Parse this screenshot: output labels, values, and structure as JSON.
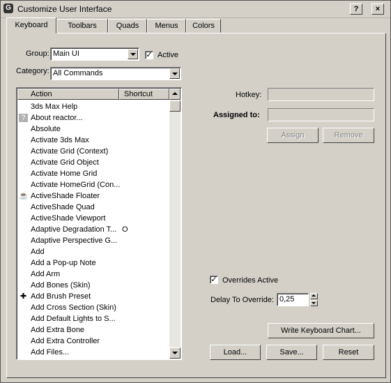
{
  "window": {
    "title": "Customize User Interface",
    "help_button": "?",
    "close_button": "×",
    "icon": "app-logo-icon"
  },
  "tabs": [
    "Keyboard",
    "Toolbars",
    "Quads",
    "Menus",
    "Colors"
  ],
  "active_tab": "Keyboard",
  "group": {
    "label": "Group:",
    "value": "Main UI"
  },
  "active_checkbox": {
    "label": "Active",
    "checked": true
  },
  "category": {
    "label": "Category:",
    "value": "All Commands"
  },
  "action_list": {
    "columns": [
      "Action",
      "Shortcut"
    ],
    "rows": [
      {
        "action": "3ds Max Help",
        "shortcut": "",
        "icon": ""
      },
      {
        "action": "About reactor...",
        "shortcut": "",
        "icon": "question-icon"
      },
      {
        "action": "Absolute",
        "shortcut": "",
        "icon": ""
      },
      {
        "action": "Activate 3ds Max",
        "shortcut": "",
        "icon": ""
      },
      {
        "action": "Activate Grid (Context)",
        "shortcut": "",
        "icon": ""
      },
      {
        "action": "Activate Grid Object",
        "shortcut": "",
        "icon": ""
      },
      {
        "action": "Activate Home Grid",
        "shortcut": "",
        "icon": ""
      },
      {
        "action": "Activate HomeGrid (Con...",
        "shortcut": "",
        "icon": ""
      },
      {
        "action": "ActiveShade Floater",
        "shortcut": "",
        "icon": "teapot-icon"
      },
      {
        "action": "ActiveShade Quad",
        "shortcut": "",
        "icon": ""
      },
      {
        "action": "ActiveShade Viewport",
        "shortcut": "",
        "icon": ""
      },
      {
        "action": "Adaptive Degradation T...",
        "shortcut": "O",
        "icon": ""
      },
      {
        "action": "Adaptive Perspective G...",
        "shortcut": "",
        "icon": ""
      },
      {
        "action": "Add",
        "shortcut": "",
        "icon": ""
      },
      {
        "action": "Add a Pop-up Note",
        "shortcut": "",
        "icon": ""
      },
      {
        "action": "Add Arm",
        "shortcut": "",
        "icon": ""
      },
      {
        "action": "Add Bones (Skin)",
        "shortcut": "",
        "icon": ""
      },
      {
        "action": "Add Brush Preset",
        "shortcut": "",
        "icon": "plus-icon"
      },
      {
        "action": "Add Cross Section (Skin)",
        "shortcut": "",
        "icon": ""
      },
      {
        "action": "Add Default Lights to S...",
        "shortcut": "",
        "icon": ""
      },
      {
        "action": "Add Extra Bone",
        "shortcut": "",
        "icon": ""
      },
      {
        "action": "Add Extra Controller",
        "shortcut": "",
        "icon": ""
      },
      {
        "action": "Add Files...",
        "shortcut": "",
        "icon": ""
      }
    ]
  },
  "hotkey": {
    "label": "Hotkey:",
    "value": ""
  },
  "assigned_to": {
    "label": "Assigned to:",
    "value": ""
  },
  "assign_button": "Assign",
  "remove_button": "Remove",
  "overrides_active": {
    "label": "Overrides Active",
    "checked": true
  },
  "delay_to_override": {
    "label": "Delay To Override:",
    "value": "0,25"
  },
  "write_chart_button": "Write Keyboard Chart...",
  "load_button": "Load...",
  "save_button": "Save...",
  "reset_button": "Reset"
}
